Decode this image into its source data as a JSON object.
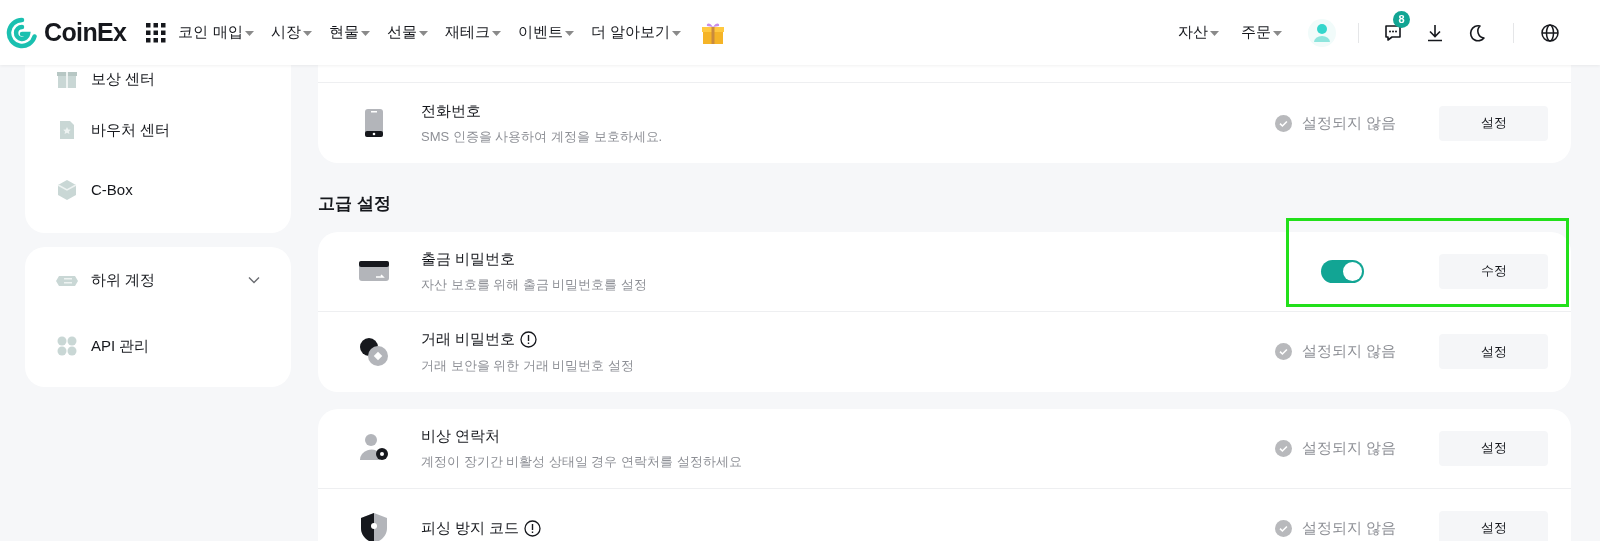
{
  "header": {
    "logo": "CoinEx",
    "menu": [
      "코인 매입",
      "시장",
      "현물",
      "선물",
      "재테크",
      "이벤트",
      "더 알아보기"
    ],
    "right_menu": [
      "자산",
      "주문"
    ],
    "notification_count": "8"
  },
  "sidebar": {
    "groups": [
      {
        "items": [
          {
            "label": "보상 센터",
            "kind": "gift"
          },
          {
            "label": "바우처 센터",
            "kind": "voucher"
          },
          {
            "label": "C-Box",
            "kind": "box"
          }
        ]
      },
      {
        "items": [
          {
            "label": "하위 계정",
            "kind": "subaccount",
            "expanded": false
          },
          {
            "label": "API 관리",
            "kind": "api"
          }
        ]
      }
    ]
  },
  "sections": [
    {
      "rows": [
        {
          "title": "전화번호",
          "description": "SMS 인증을 사용하여 계정을 보호하세요.",
          "info": false,
          "kind": "status",
          "status": "설정되지 않음",
          "button": "설정",
          "highlighted": false
        }
      ]
    },
    {
      "heading": "고급 설정",
      "rows": [
        {
          "title": "출금 비밀번호",
          "description": "자산 보호를 위해 출금 비밀번호를 설정",
          "info": false,
          "kind": "toggle",
          "on": true,
          "button": "수정",
          "highlighted": true
        },
        {
          "title": "거래 비밀번호",
          "description": "거래 보안을 위한 거래 비밀번호 설정",
          "info": true,
          "kind": "status",
          "status": "설정되지 않음",
          "button": "설정",
          "highlighted": false
        }
      ]
    },
    {
      "rows": [
        {
          "title": "비상 연락처",
          "description": "계정이 장기간 비활성 상태일 경우 연락처를 설정하세요",
          "info": false,
          "kind": "status",
          "status": "설정되지 않음",
          "button": "설정",
          "highlighted": false
        },
        {
          "title": "피싱 방지 코드",
          "info": true,
          "kind": "status",
          "status": "설정되지 않음",
          "button": "설정",
          "highlighted": false
        }
      ]
    }
  ]
}
